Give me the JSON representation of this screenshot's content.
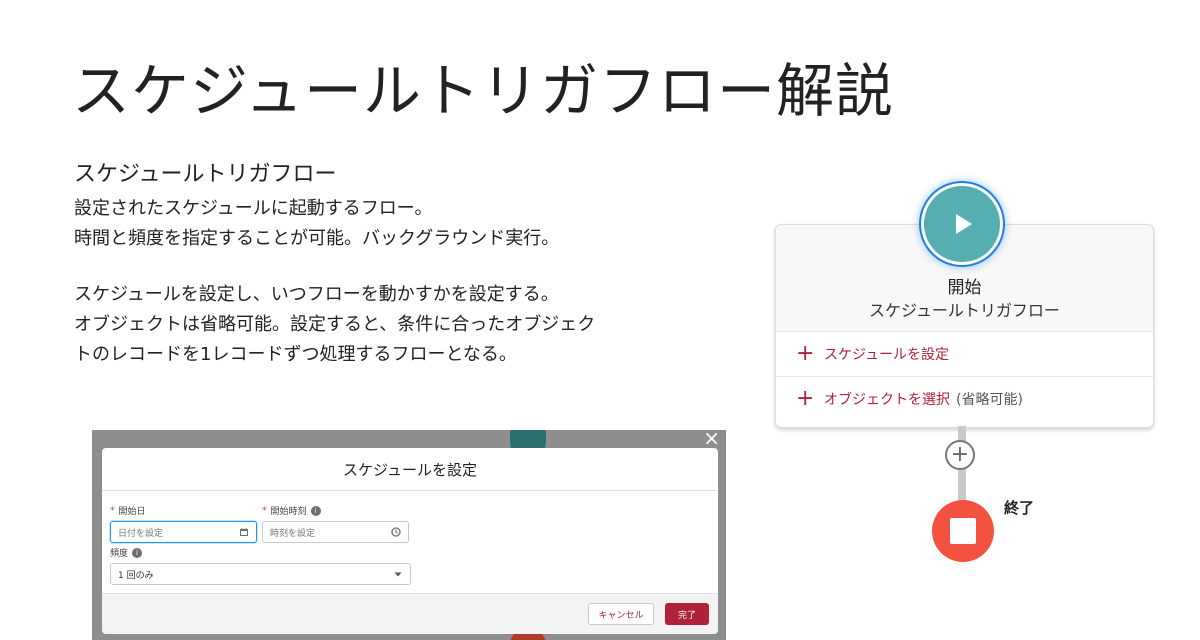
{
  "page": {
    "title": "スケジュールトリガフロー解説"
  },
  "description": {
    "heading": "スケジュールトリガフロー",
    "lines_1": [
      "設定されたスケジュールに起動するフロー。",
      "時間と頻度を指定することが可能。バックグラウンド実行。"
    ],
    "lines_2": [
      "スケジュールを設定し、いつフローを動かすかを設定する。",
      "オブジェクトは省略可能。設定すると、条件に合ったオブジェク",
      "トのレコードを1レコードずつ処理するフローとなる。"
    ]
  },
  "modal": {
    "title": "スケジュールを設定",
    "close_glyph": "×",
    "start_date": {
      "label": "開始日",
      "required_mark": "*",
      "placeholder": "日付を設定",
      "icon": "calendar-icon"
    },
    "start_time": {
      "label": "開始時刻",
      "required_mark": "*",
      "placeholder": "時刻を設定",
      "icon": "clock-icon"
    },
    "frequency": {
      "label": "頻度",
      "value": "1 回のみ",
      "icon": "chevron-down-icon"
    },
    "info_glyph": "i",
    "cancel_label": "キャンセル",
    "done_label": "完了"
  },
  "flow": {
    "start_title": "開始",
    "start_subtitle": "スケジュールトリガフロー",
    "rows": [
      {
        "plus": "+",
        "link": "スケジュールを設定",
        "note": ""
      },
      {
        "plus": "+",
        "link": "オブジェクトを選択",
        "note": "(省略可能)"
      }
    ],
    "add_glyph": "+",
    "end_label": "終了",
    "colors": {
      "start": "#56aeb0",
      "end": "#f2523f",
      "accent": "#b0213b",
      "focus": "#1b7fe6"
    }
  }
}
